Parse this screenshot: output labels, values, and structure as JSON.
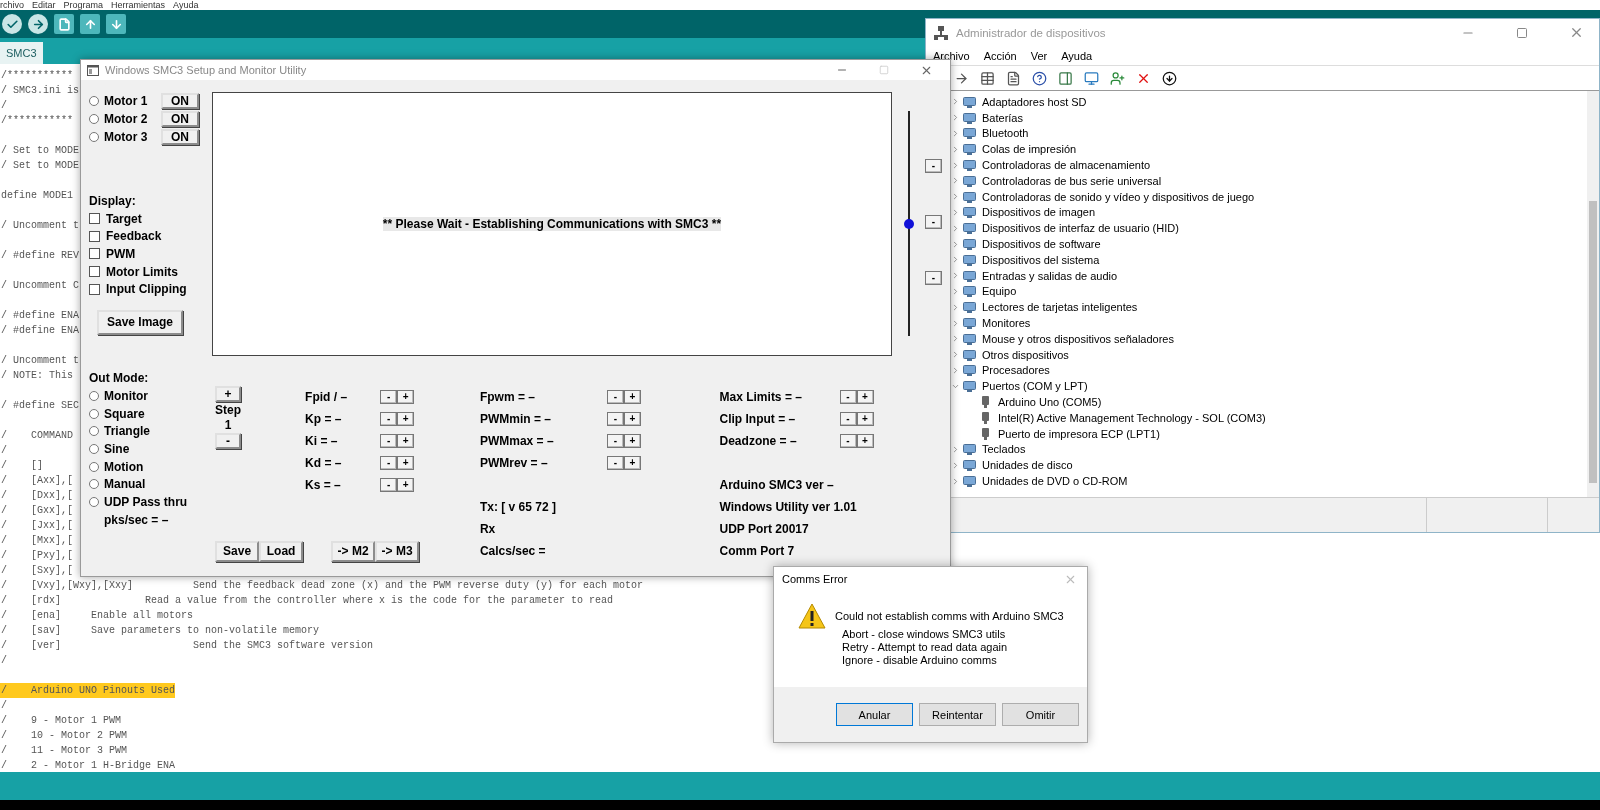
{
  "arduino_ide": {
    "menu": [
      "rchivo",
      "Editar",
      "Programa",
      "Herramientas",
      "Ayuda"
    ],
    "tab": "SMC3",
    "code_blocks": [
      [
        {
          "text": "/***********",
          "highlighted": false
        },
        {
          "text": "/ SMC3.ini is",
          "highlighted": false
        },
        {
          "text": "/",
          "highlighted": false
        },
        {
          "text": "/***********",
          "highlighted": false
        }
      ],
      [
        {
          "text": "/ Set to MODE",
          "highlighted": false
        },
        {
          "text": "/ Set to MODE",
          "highlighted": false
        }
      ],
      [
        {
          "text": "define MODE1",
          "highlighted": false
        }
      ],
      [
        {
          "text": "/ Uncomment t",
          "highlighted": false
        }
      ],
      [
        {
          "text": "/ #define REV",
          "highlighted": false
        }
      ],
      [
        {
          "text": "/ Uncomment C",
          "highlighted": false
        }
      ],
      [
        {
          "text": "/ #define ENA",
          "highlighted": false
        },
        {
          "text": "/ #define ENA",
          "highlighted": false
        }
      ],
      [
        {
          "text": "/ Uncomment t",
          "highlighted": false
        },
        {
          "text": "/ NOTE: This",
          "highlighted": false
        }
      ],
      [
        {
          "text": "/ #define SEC",
          "highlighted": false
        }
      ],
      [
        {
          "text": "/    COMMAND",
          "highlighted": false
        },
        {
          "text": "/",
          "highlighted": false
        },
        {
          "text": "/    []",
          "highlighted": false
        },
        {
          "text": "/    [Axx],[",
          "highlighted": false
        },
        {
          "text": "/    [Dxx],[",
          "highlighted": false
        },
        {
          "text": "/    [Gxx],[",
          "highlighted": false
        },
        {
          "text": "/    [Jxx],[",
          "highlighted": false
        },
        {
          "text": "/    [Mxx],[",
          "highlighted": false
        },
        {
          "text": "/    [Pxy],[",
          "highlighted": false
        },
        {
          "text": "/    [Sxy],[",
          "highlighted": false
        },
        {
          "text": "/    [Vxy],[Wxy],[Xxy]          Send the feedback dead zone (x) and the PWM reverse duty (y) for each motor",
          "highlighted": false
        },
        {
          "text": "/    [rdx]              Read a value from the controller where x is the code for the parameter to read",
          "highlighted": false
        },
        {
          "text": "/    [ena]     Enable all motors",
          "highlighted": false
        },
        {
          "text": "/    [sav]     Save parameters to non-volatile memory",
          "highlighted": false
        },
        {
          "text": "/    [ver]                      Send the SMC3 software version",
          "highlighted": false
        },
        {
          "text": "/",
          "highlighted": false
        }
      ],
      [
        {
          "text": "/    Arduino UNO Pinouts Used",
          "highlighted": true
        },
        {
          "text": "/",
          "highlighted": false
        },
        {
          "text": "/    9 - Motor 1 PWM",
          "highlighted": false
        },
        {
          "text": "/    10 - Motor 2 PWM",
          "highlighted": false
        },
        {
          "text": "/    11 - Motor 3 PWM",
          "highlighted": false
        },
        {
          "text": "/    2 - Motor 1 H-Bridge ENA",
          "highlighted": false
        }
      ]
    ]
  },
  "smc3_window": {
    "title": "Windows SMC3 Setup and Monitor Utility",
    "motors": [
      {
        "label": "Motor 1",
        "selected": false,
        "button": "ON"
      },
      {
        "label": "Motor 2",
        "selected": false,
        "button": "ON"
      },
      {
        "label": "Motor 3",
        "selected": false,
        "button": "ON"
      }
    ],
    "display_label": "Display:",
    "display_options": [
      {
        "label": "Target",
        "checked": false
      },
      {
        "label": "Feedback",
        "checked": false
      },
      {
        "label": "PWM",
        "checked": false
      },
      {
        "label": "Motor Limits",
        "checked": false
      },
      {
        "label": "Input Clipping",
        "checked": false
      }
    ],
    "save_image": "Save Image",
    "canvas_message": "** Please Wait - Establishing Communications with SMC3 **",
    "slider": {
      "level": 0.5
    },
    "slider_buttons": [
      "-",
      "-",
      "-"
    ],
    "out_mode_label": "Out Mode:",
    "out_modes": [
      {
        "label": "Monitor",
        "selected": false
      },
      {
        "label": "Square",
        "selected": false
      },
      {
        "label": "Triangle",
        "selected": false
      },
      {
        "label": "Sine",
        "selected": false
      },
      {
        "label": "Motion",
        "selected": false
      },
      {
        "label": "Manual",
        "selected": false
      },
      {
        "label": "UDP Pass thru",
        "selected": false
      }
    ],
    "pks_sec": "pks/sec = –",
    "step": {
      "increase": "+",
      "label": "Step",
      "value": "1",
      "decrease": "-"
    },
    "file_buttons": [
      "Save",
      "Load"
    ],
    "copy_buttons": [
      "-> M2",
      "-> M3"
    ],
    "param_columns": [
      [
        {
          "label": "Fpid / –",
          "decrease": "-",
          "increase": "+"
        },
        {
          "label": "Kp = –",
          "decrease": "-",
          "increase": "+"
        },
        {
          "label": "Ki = –",
          "decrease": "-",
          "increase": "+"
        },
        {
          "label": "Kd = –",
          "decrease": "-",
          "increase": "+"
        },
        {
          "label": "Ks = –",
          "decrease": "-",
          "increase": "+"
        }
      ],
      [
        {
          "label": "Fpwm = –",
          "decrease": "-",
          "increase": "+"
        },
        {
          "label": "PWMmin = –",
          "decrease": "-",
          "increase": "+"
        },
        {
          "label": "PWMmax = –",
          "decrease": "-",
          "increase": "+"
        },
        {
          "label": "PWMrev = –",
          "decrease": "-",
          "increase": "+"
        }
      ],
      [
        {
          "label": "Max Limits = –",
          "decrease": "-",
          "increase": "+"
        },
        {
          "label": "Clip Input = –",
          "decrease": "-",
          "increase": "+"
        },
        {
          "label": "Deadzone = –",
          "decrease": "-",
          "increase": "+"
        }
      ]
    ],
    "status": [
      "Tx: [ v 65 72 ]",
      "Rx",
      "Calcs/sec ="
    ],
    "info": [
      "Arduino SMC3 ver –",
      "Windows Utility ver 1.01",
      "UDP Port 20017",
      "Comm Port 7"
    ]
  },
  "device_manager": {
    "title": "Administrador de dispositivos",
    "menu": [
      "Archivo",
      "Acción",
      "Ver",
      "Ayuda"
    ],
    "tree": [
      {
        "label": "Adaptadores host SD",
        "expanded": false
      },
      {
        "label": "Baterías",
        "expanded": false
      },
      {
        "label": "Bluetooth",
        "expanded": false
      },
      {
        "label": "Colas de impresión",
        "expanded": false
      },
      {
        "label": "Controladoras de almacenamiento",
        "expanded": false
      },
      {
        "label": "Controladoras de bus serie universal",
        "expanded": false
      },
      {
        "label": "Controladoras de sonido y vídeo y dispositivos de juego",
        "expanded": false
      },
      {
        "label": "Dispositivos de imagen",
        "expanded": false
      },
      {
        "label": "Dispositivos de interfaz de usuario (HID)",
        "expanded": false
      },
      {
        "label": "Dispositivos de software",
        "expanded": false
      },
      {
        "label": "Dispositivos del sistema",
        "expanded": false
      },
      {
        "label": "Entradas y salidas de audio",
        "expanded": false
      },
      {
        "label": "Equipo",
        "expanded": false
      },
      {
        "label": "Lectores de tarjetas inteligentes",
        "expanded": false
      },
      {
        "label": "Monitores",
        "expanded": false
      },
      {
        "label": "Mouse y otros dispositivos señaladores",
        "expanded": false
      },
      {
        "label": "Otros dispositivos",
        "expanded": false
      },
      {
        "label": "Procesadores",
        "expanded": false
      },
      {
        "label": "Puertos (COM y LPT)",
        "expanded": true,
        "children": [
          {
            "label": "Arduino Uno (COM5)"
          },
          {
            "label": "Intel(R) Active Management Technology - SOL (COM3)"
          },
          {
            "label": "Puerto de impresora ECP (LPT1)"
          }
        ]
      },
      {
        "label": "Teclados",
        "expanded": false
      },
      {
        "label": "Unidades de disco",
        "expanded": false
      },
      {
        "label": "Unidades de DVD o CD-ROM",
        "expanded": false
      }
    ]
  },
  "dialog": {
    "title": "Comms Error",
    "message": "Could not establish comms with Arduino SMC3",
    "details": [
      "Abort - close windows SMC3 utils",
      "Retry - Attempt to read data again",
      "Ignore - disable Arduino comms"
    ],
    "buttons": [
      "Anular",
      "Reintentar",
      "Omitir"
    ]
  }
}
